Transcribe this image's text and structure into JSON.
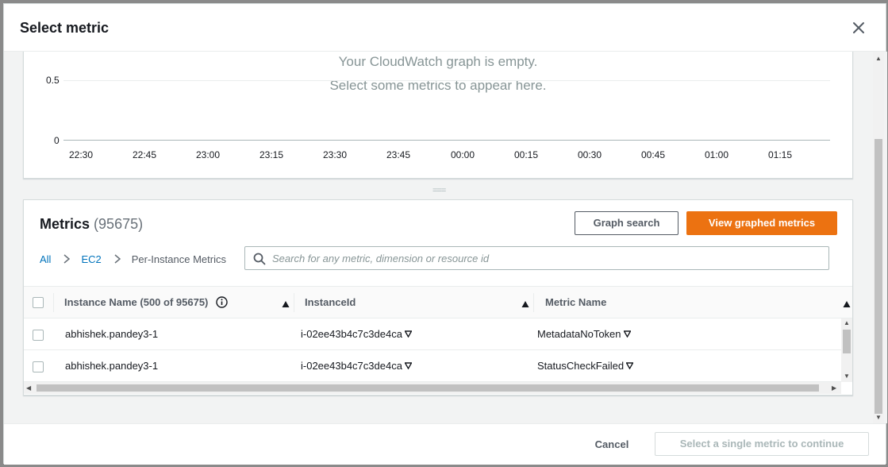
{
  "modal": {
    "title": "Select metric",
    "close_icon": "close-icon"
  },
  "graph": {
    "empty_line1": "Your CloudWatch graph is empty.",
    "empty_line2": "Select some metrics to appear here.",
    "y_ticks": [
      "0.5",
      "0"
    ],
    "x_ticks": [
      "22:30",
      "22:45",
      "23:00",
      "23:15",
      "23:30",
      "23:45",
      "00:00",
      "00:15",
      "00:30",
      "00:45",
      "01:00",
      "01:15"
    ]
  },
  "splitter": "===",
  "metrics": {
    "title": "Metrics",
    "count": "(95675)",
    "graph_search_label": "Graph search",
    "view_graphed_label": "View graphed metrics",
    "breadcrumb": {
      "all": "All",
      "ec2": "EC2",
      "current": "Per-Instance Metrics"
    },
    "search": {
      "value": "",
      "placeholder": "Search for any metric, dimension or resource id"
    },
    "columns": {
      "instance_name": "Instance Name",
      "instance_name_count": "(500 of 95675)",
      "instance_id": "InstanceId",
      "metric_name": "Metric Name"
    },
    "rows": [
      {
        "instance_name": "abhishek.pandey3-1",
        "instance_id": "i-02ee43b4c7c3de4ca",
        "metric_name": "MetadataNoToken"
      },
      {
        "instance_name": "abhishek.pandey3-1",
        "instance_id": "i-02ee43b4c7c3de4ca",
        "metric_name": "StatusCheckFailed"
      }
    ]
  },
  "footer": {
    "cancel_label": "Cancel",
    "continue_label": "Select a single metric to continue"
  },
  "colors": {
    "primary": "#ec7211",
    "link": "#0073bb"
  }
}
